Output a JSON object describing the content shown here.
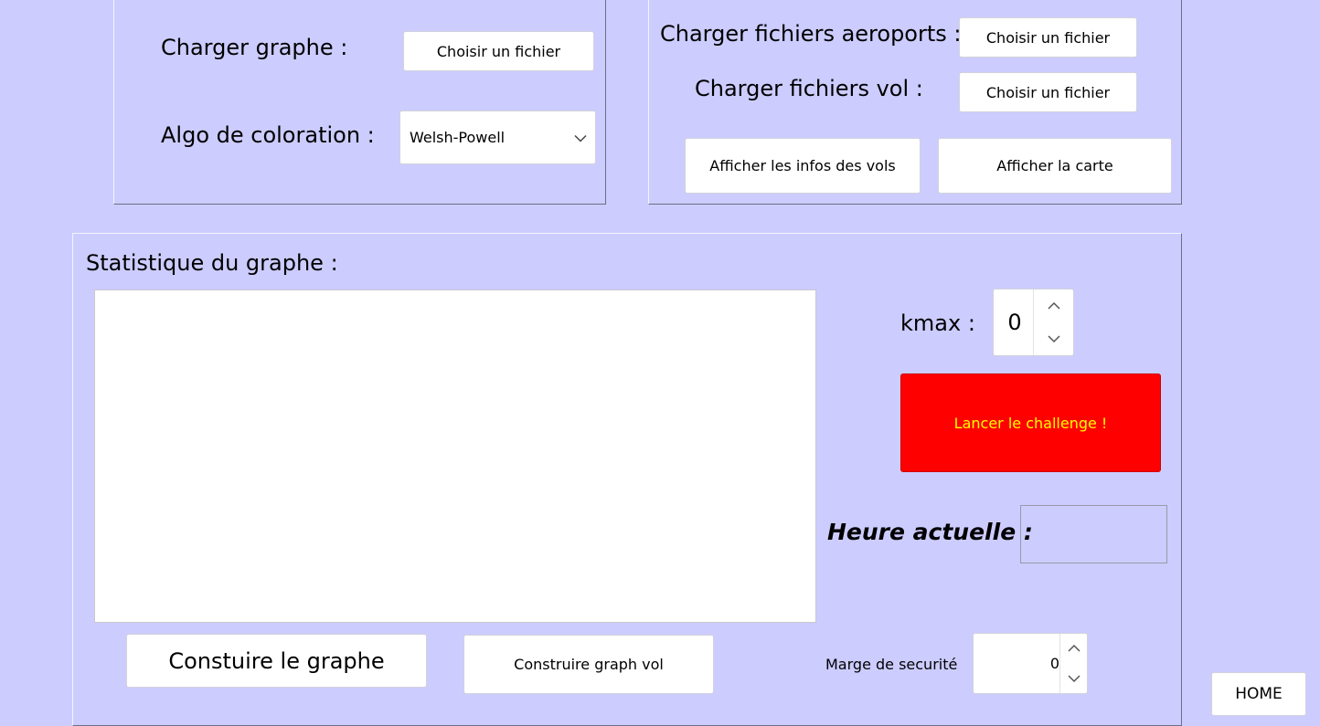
{
  "graph_panel": {
    "load_graph_label": "Charger graphe :",
    "choose_file_label": "Choisir un fichier",
    "algo_label": "Algo de coloration :",
    "algo_selected": "Welsh-Powell"
  },
  "flight_panel": {
    "airports_label": "Charger fichiers aeroports :",
    "airports_choose_label": "Choisir un fichier",
    "flights_label": "Charger fichiers vol :",
    "flights_choose_label": "Choisir un fichier",
    "show_flight_info_label": "Afficher les infos des vols",
    "show_map_label": "Afficher la carte"
  },
  "stats_panel": {
    "title": "Statistique du graphe :",
    "kmax_label": "kmax :",
    "kmax_value": "0",
    "challenge_label": "Lancer le challenge !",
    "current_time_label": "Heure actuelle :",
    "build_graph_label": "Constuire le graphe",
    "build_flight_graph_label": "Construire graph vol",
    "safety_margin_label": "Marge de securité",
    "safety_margin_value": "0"
  },
  "home_label": "HOME",
  "colors": {
    "background": "#ccccff",
    "challenge_button": "#ff0000",
    "challenge_text": "#ffff00"
  },
  "icons": {
    "dropdown": "chevron-down-icon",
    "spinner_up": "chevron-up-icon",
    "spinner_down": "chevron-down-icon"
  }
}
